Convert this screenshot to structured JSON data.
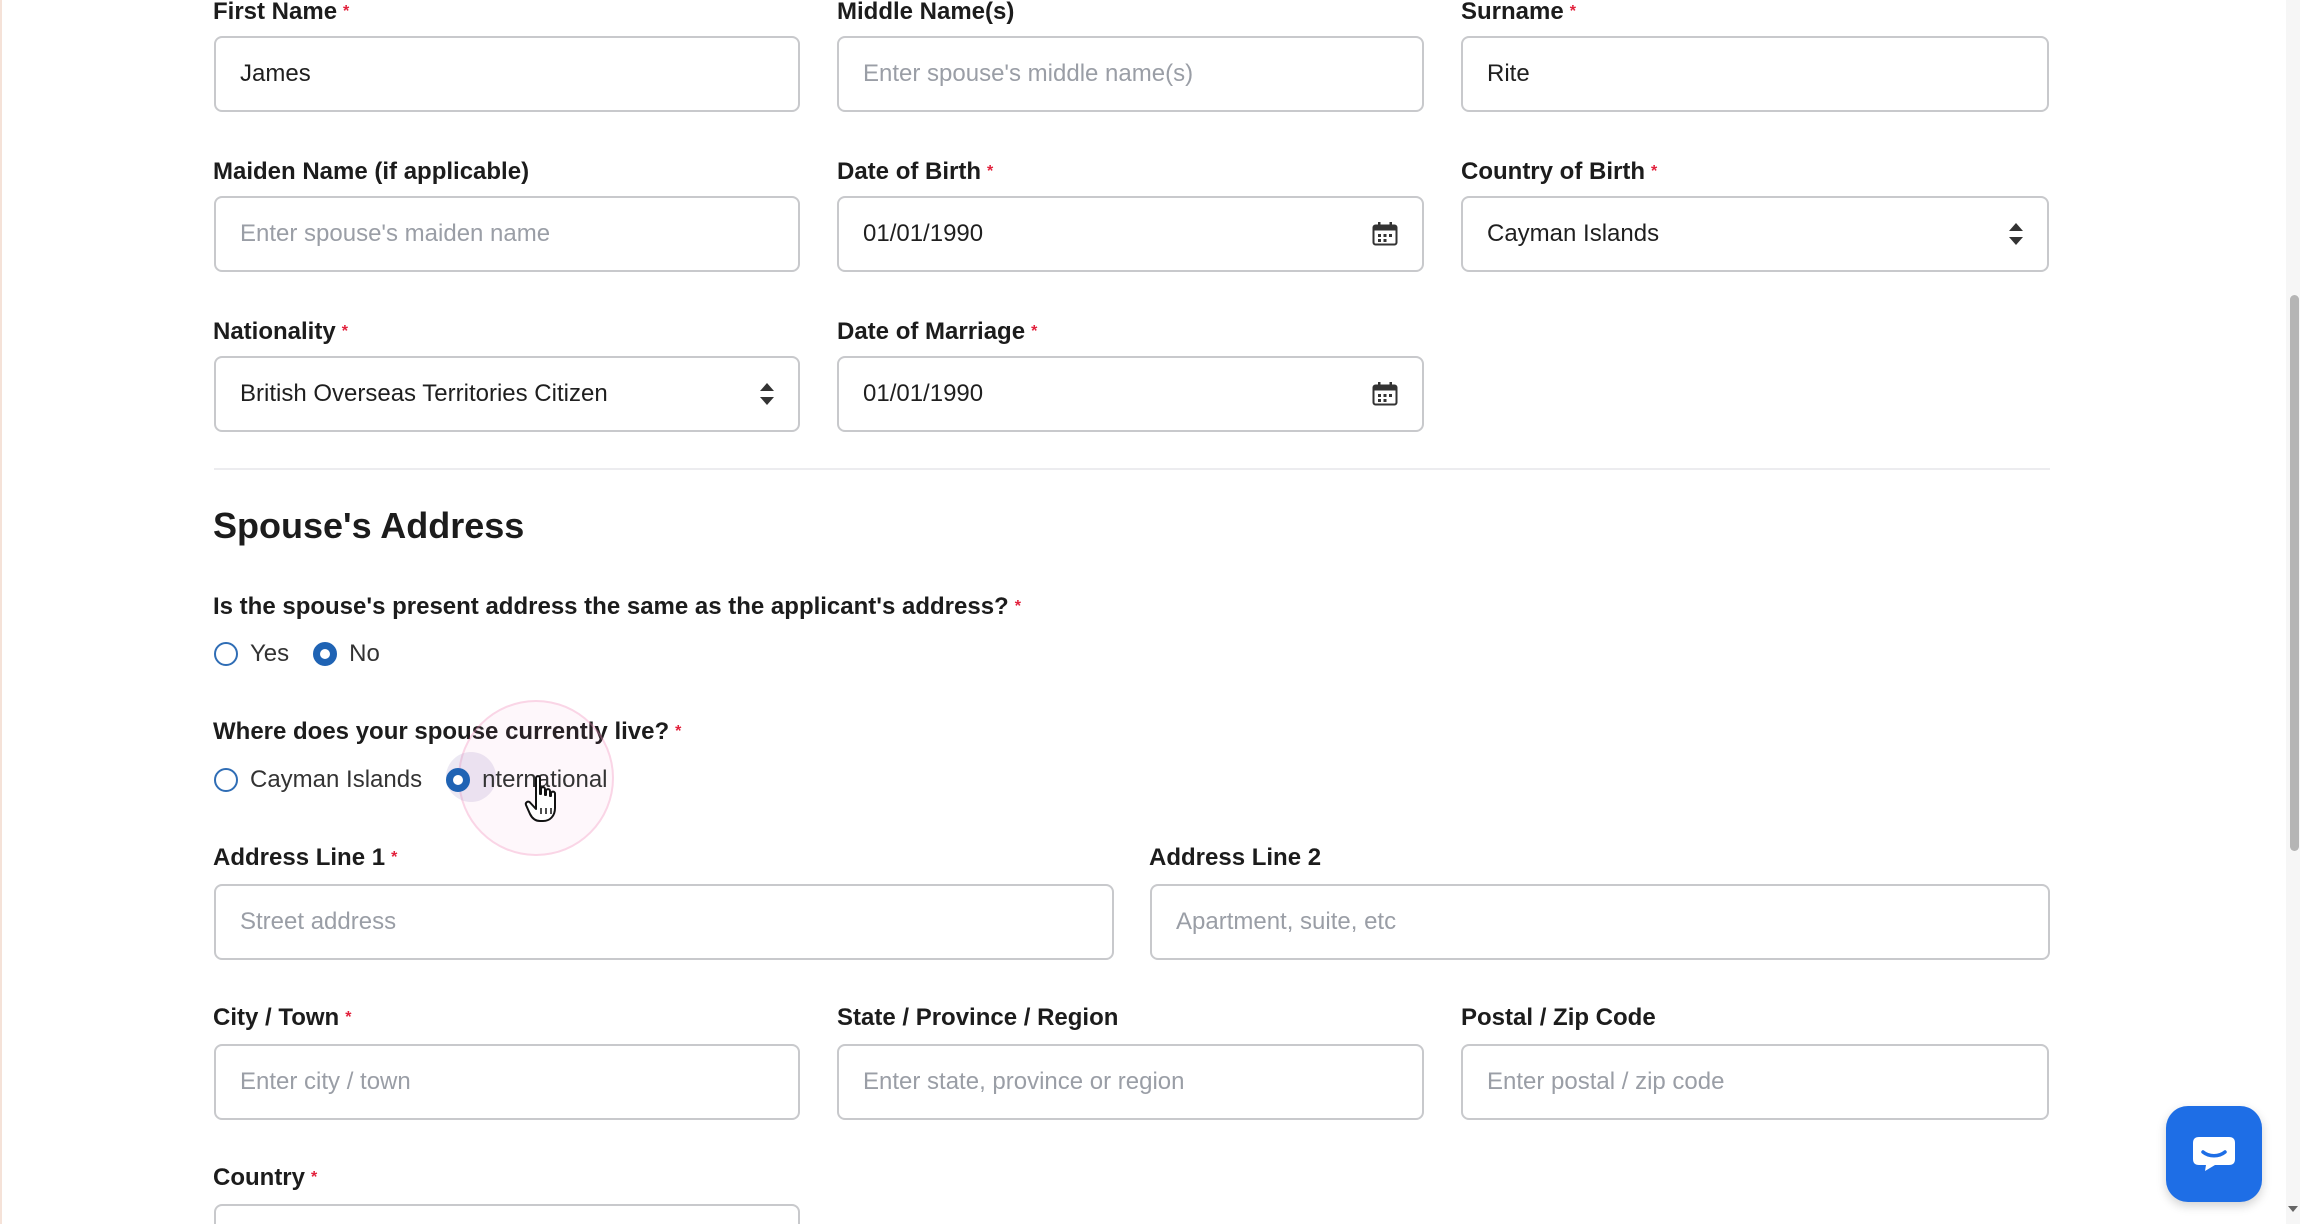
{
  "personal": {
    "first_name": {
      "label": "First Name",
      "required": "*",
      "value": "James"
    },
    "middle_names": {
      "label": "Middle Name(s)",
      "placeholder": "Enter spouse's middle name(s)"
    },
    "surname": {
      "label": "Surname",
      "required": "*",
      "value": "Rite"
    },
    "maiden_name": {
      "label": "Maiden Name (if applicable)",
      "placeholder": "Enter spouse's maiden name"
    },
    "date_of_birth": {
      "label": "Date of Birth",
      "required": "*",
      "value": "01/01/1990",
      "icon": "calendar-icon"
    },
    "country_of_birth": {
      "label": "Country of Birth",
      "required": "*",
      "value": "Cayman Islands",
      "icon": "updown-icon"
    },
    "nationality": {
      "label": "Nationality",
      "required": "*",
      "value": "British Overseas Territories Citizen",
      "icon": "updown-icon"
    },
    "date_of_marriage": {
      "label": "Date of Marriage",
      "required": "*",
      "value": "01/01/1990",
      "icon": "calendar-icon"
    }
  },
  "address_section": {
    "title": "Spouse's Address",
    "same_address": {
      "question": "Is the spouse's present address the same as the applicant's address?",
      "required": "*",
      "options": [
        {
          "label": "Yes",
          "checked": false
        },
        {
          "label": "No",
          "checked": true
        }
      ]
    },
    "residence": {
      "question": "Where does your spouse currently live?",
      "required": "*",
      "options": [
        {
          "label": "Cayman Islands",
          "checked": false
        },
        {
          "label": "nternational",
          "checked": true
        }
      ]
    },
    "address_line_1": {
      "label": "Address Line 1",
      "required": "*",
      "placeholder": "Street address"
    },
    "address_line_2": {
      "label": "Address Line 2",
      "placeholder": "Apartment, suite, etc"
    },
    "city": {
      "label": "City / Town",
      "required": "*",
      "placeholder": "Enter city / town"
    },
    "state": {
      "label": "State / Province / Region",
      "placeholder": "Enter state, province or region"
    },
    "postal": {
      "label": "Postal / Zip Code",
      "placeholder": "Enter postal / zip code"
    },
    "country": {
      "label": "Country",
      "required": "*"
    }
  },
  "colors": {
    "accent": "#1f63b4",
    "required": "#e2213c",
    "chat_button": "#1e6ee6",
    "border": "#c8c9cc",
    "placeholder": "#9a9ea6"
  },
  "chat": {
    "icon": "chat-bubble-icon"
  }
}
